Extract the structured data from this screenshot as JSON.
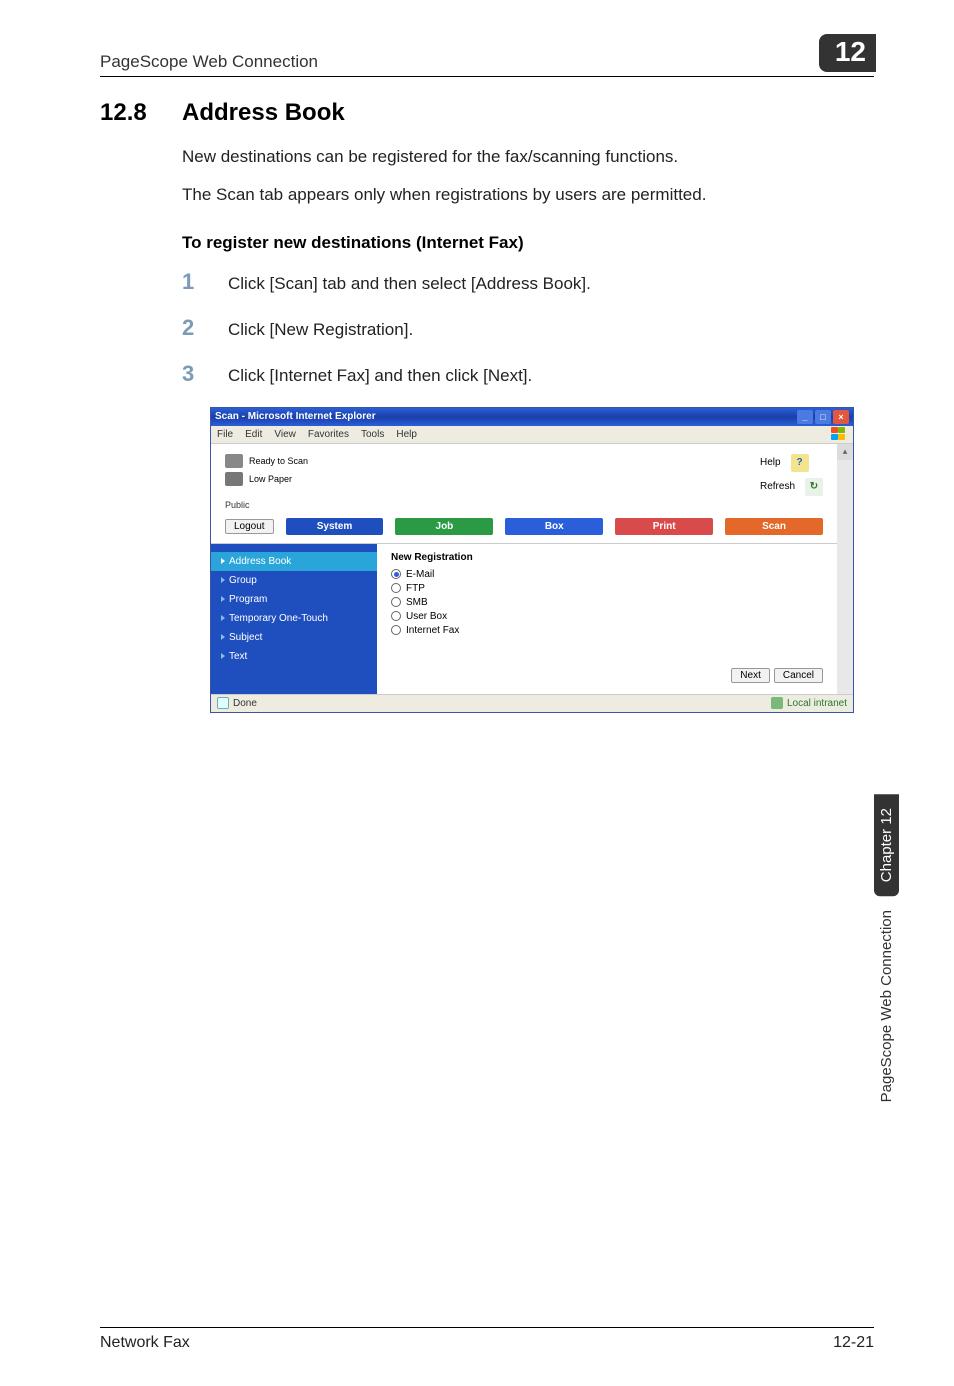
{
  "header": {
    "title": "PageScope Web Connection",
    "chapter_number": "12"
  },
  "section": {
    "number": "12.8",
    "title": "Address Book",
    "paragraphs": [
      "New destinations can be registered for the fax/scanning functions.",
      "The Scan tab appears only when registrations by users are permitted."
    ],
    "subheading": "To register new destinations (Internet Fax)",
    "steps": [
      {
        "num": "1",
        "text": "Click [Scan] tab and then select [Address Book]."
      },
      {
        "num": "2",
        "text": "Click [New Registration]."
      },
      {
        "num": "3",
        "text": "Click [Internet Fax] and then click [Next]."
      }
    ]
  },
  "screenshot": {
    "window_title": "Scan - Microsoft Internet Explorer",
    "menus": [
      "File",
      "Edit",
      "View",
      "Favorites",
      "Tools",
      "Help"
    ],
    "status_msgs": {
      "ready": "Ready to Scan",
      "paper": "Low Paper"
    },
    "help_labels": {
      "help": "Help",
      "refresh": "Refresh",
      "help_icon": "?",
      "refresh_icon": "↻"
    },
    "user_mode": "Public",
    "logout": "Logout",
    "tabs": {
      "system": "System",
      "job": "Job",
      "box": "Box",
      "print": "Print",
      "scan": "Scan"
    },
    "sidebar": [
      "Address Book",
      "Group",
      "Program",
      "Temporary One-Touch",
      "Subject",
      "Text"
    ],
    "form": {
      "title": "New Registration",
      "options": [
        "E-Mail",
        "FTP",
        "SMB",
        "User Box",
        "Internet Fax"
      ],
      "selected": "E-Mail",
      "next": "Next",
      "cancel": "Cancel"
    },
    "statusbar": {
      "done": "Done",
      "zone": "Local intranet"
    }
  },
  "side": {
    "chapter": "Chapter 12",
    "label": "PageScope Web Connection"
  },
  "footer": {
    "left": "Network Fax",
    "right": "12-21"
  }
}
